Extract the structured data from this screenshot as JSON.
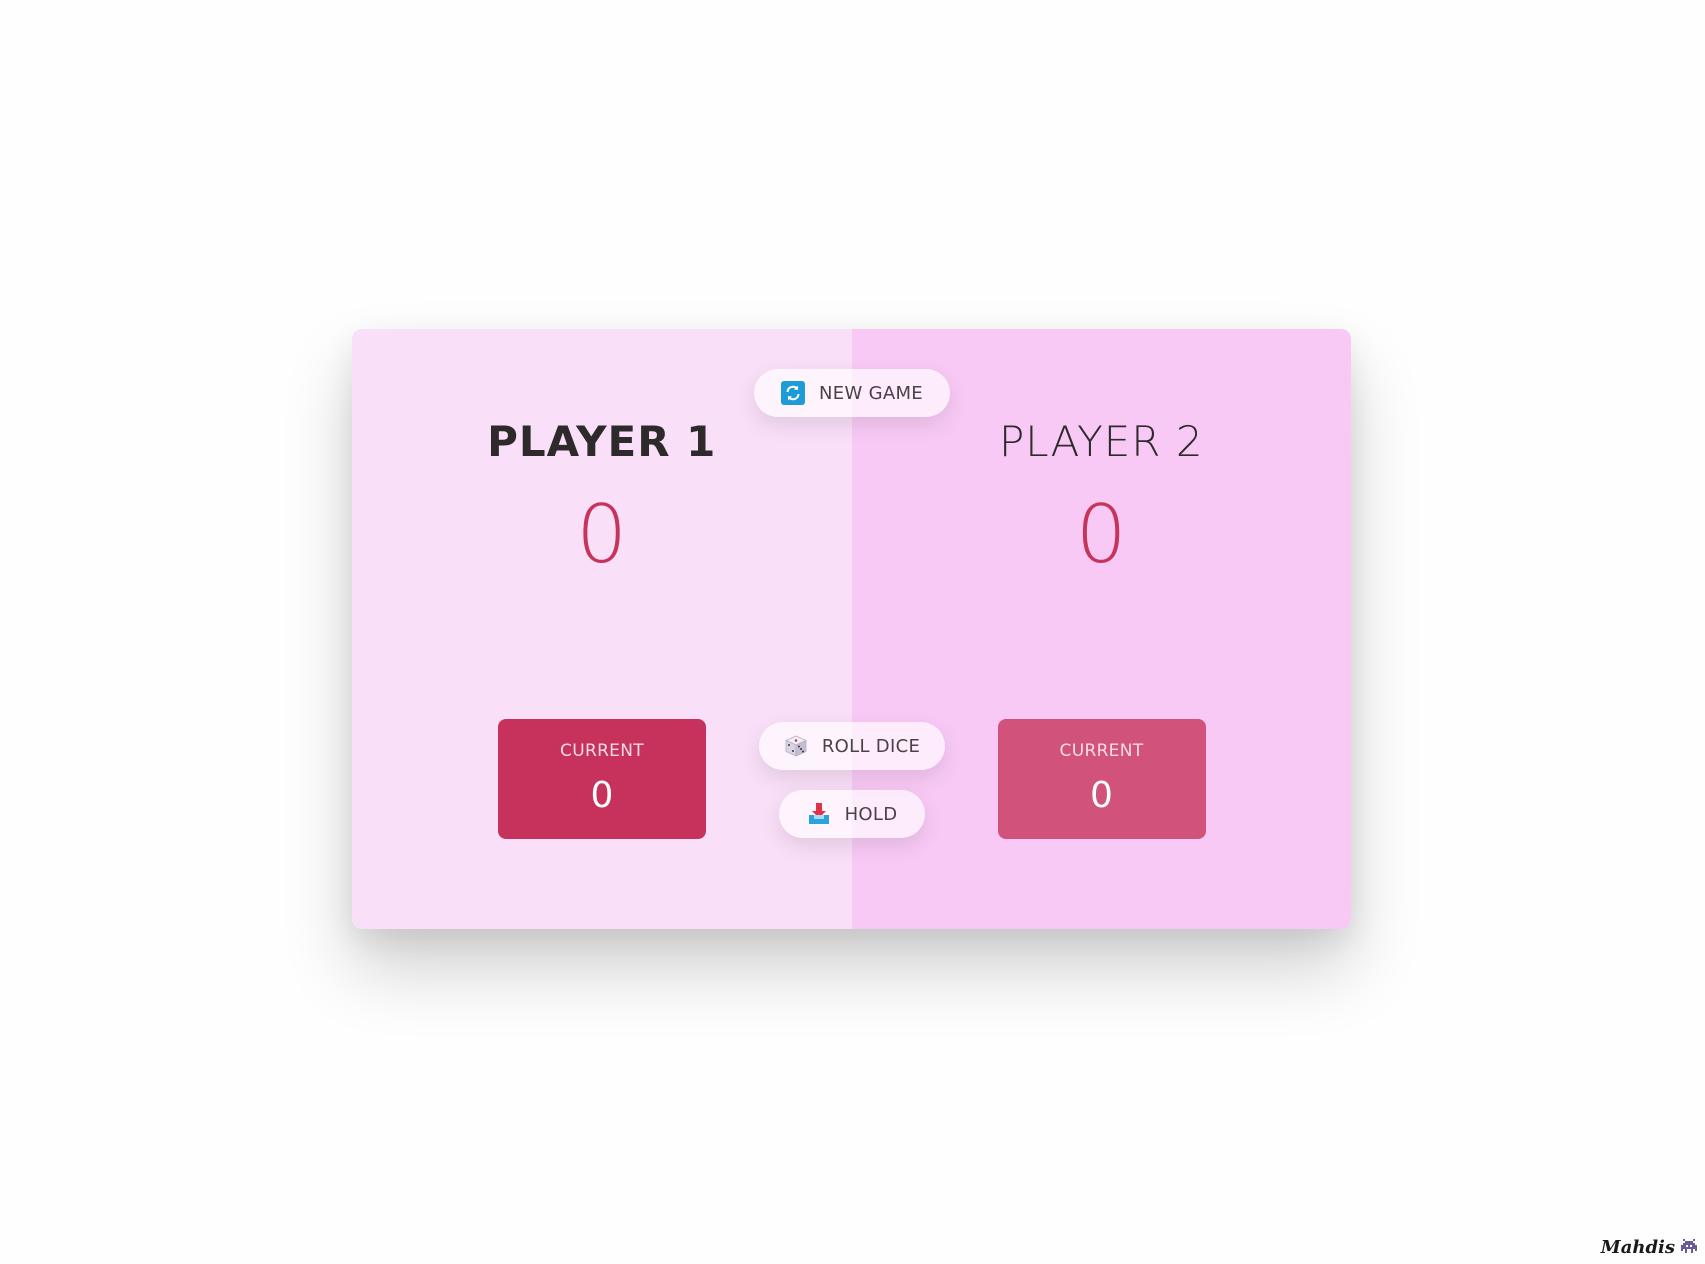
{
  "players": [
    {
      "name": "PLAYER 1",
      "score": "0",
      "current_label": "CURRENT",
      "current_score": "0",
      "active": true
    },
    {
      "name": "PLAYER 2",
      "score": "0",
      "current_label": "CURRENT",
      "current_score": "0",
      "active": false
    }
  ],
  "buttons": {
    "new_game": {
      "label": "NEW GAME",
      "icon": "refresh-icon"
    },
    "roll_dice": {
      "label": "ROLL DICE",
      "icon": "dice-icon"
    },
    "hold": {
      "label": "HOLD",
      "icon": "inbox-tray-icon"
    }
  },
  "signature": {
    "text": "Mahdis",
    "icon": "space-invader-icon"
  },
  "colors": {
    "active_panel": "#f9dff8",
    "inactive_panel": "#f8c9f5",
    "score": "#c6345c",
    "active_current_box": "#c6325c",
    "inactive_current_box": "#d1527b"
  }
}
